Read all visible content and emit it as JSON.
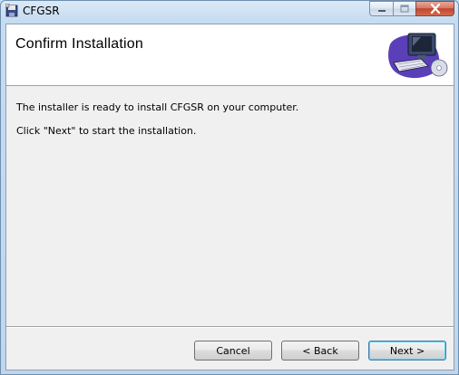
{
  "window": {
    "title": "CFGSR"
  },
  "header": {
    "title": "Confirm Installation"
  },
  "content": {
    "line1": "The installer is ready to install CFGSR on your computer.",
    "line2": "Click \"Next\" to start the installation."
  },
  "buttons": {
    "cancel": "Cancel",
    "back": "< Back",
    "next": "Next >"
  },
  "icons": {
    "app": "installer-disk-icon",
    "header": "computer-setup-icon"
  }
}
